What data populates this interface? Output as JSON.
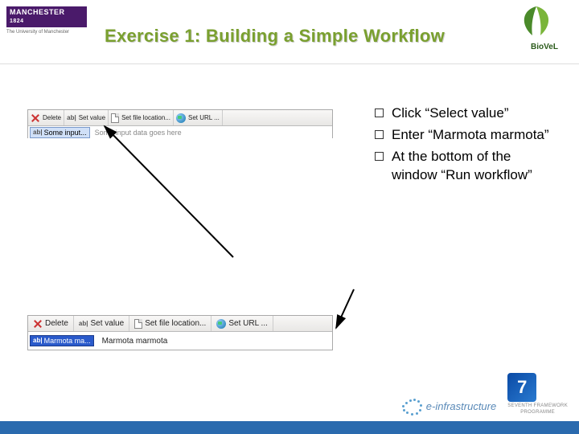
{
  "header": {
    "manchester_title": "MANCHESTER",
    "manchester_year": "1824",
    "manchester_sub": "The University of Manchester",
    "title": "Exercise 1: Building a Simple Workflow",
    "biovel_label": "BioVeL"
  },
  "panel1": {
    "toolbar": {
      "delete": "Delete",
      "set_value": "Set value",
      "set_file": "Set file location...",
      "set_url": "Set URL ..."
    },
    "input_label": "Some input...",
    "hint": "Some input data goes here"
  },
  "panel2": {
    "toolbar": {
      "delete": "Delete",
      "set_value": "Set value",
      "set_file": "Set file location...",
      "set_url": "Set URL ..."
    },
    "input_label": "Marmota ma...",
    "value": "Marmota marmota"
  },
  "instructions": {
    "items": [
      "Click “Select value”",
      "Enter “Marmota marmota”",
      "At the bottom of the window “Run workflow”"
    ]
  },
  "footer": {
    "einfra": "e-infrastructure",
    "seventh_num": "7",
    "seventh_label": "SEVENTH FRAMEWORK",
    "seventh_prog": "PROGRAMME"
  }
}
